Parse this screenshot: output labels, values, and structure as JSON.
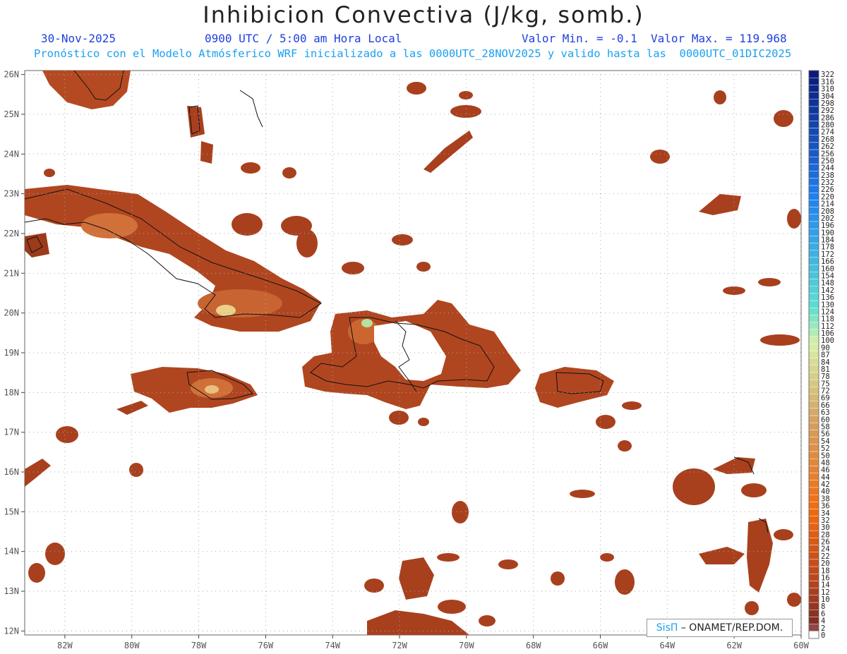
{
  "title": "Inhibicion Convectiva (J/kg, somb.)",
  "date": "30-Nov-2025",
  "time": "0900 UTC / 5:00 am Hora Local",
  "minmax": "Valor Min. = -0.1  Valor Max. = 119.968",
  "forecast": "Pronóstico con el Modelo Atmósferico WRF inicializado a las 0000UTC_28NOV2025 y valido hasta las  0000UTC_01DIC2025",
  "credit": {
    "brand": "SisΠ",
    "text": " – ONAMET/REP.DOM."
  },
  "map": {
    "lon_labels": [
      "82W",
      "80W",
      "78W",
      "76W",
      "74W",
      "72W",
      "70W",
      "68W",
      "66W",
      "64W",
      "62W",
      "60W"
    ],
    "lon_values": [
      -82,
      -80,
      -78,
      -76,
      -74,
      -72,
      -70,
      -68,
      -66,
      -64,
      -62,
      -60
    ],
    "lat_labels": [
      "26N",
      "25N",
      "24N",
      "23N",
      "22N",
      "21N",
      "20N",
      "19N",
      "18N",
      "17N",
      "16N",
      "15N",
      "14N",
      "13N",
      "12N"
    ],
    "lat_values": [
      26,
      25,
      24,
      23,
      22,
      21,
      20,
      19,
      18,
      17,
      16,
      15,
      14,
      13,
      12
    ],
    "lon_range": [
      -83.2,
      -60
    ],
    "lat_range": [
      11.9,
      26.1
    ],
    "grid": true
  },
  "colorbar": {
    "labels": [
      "322",
      "316",
      "310",
      "304",
      "298",
      "292",
      "286",
      "280",
      "274",
      "268",
      "262",
      "256",
      "250",
      "244",
      "238",
      "232",
      "226",
      "220",
      "214",
      "208",
      "202",
      "196",
      "190",
      "184",
      "178",
      "172",
      "166",
      "160",
      "154",
      "148",
      "142",
      "136",
      "130",
      "124",
      "118",
      "112",
      "106",
      "100",
      "90",
      "87",
      "84",
      "81",
      "78",
      "75",
      "72",
      "69",
      "66",
      "63",
      "60",
      "58",
      "56",
      "54",
      "52",
      "50",
      "48",
      "46",
      "44",
      "42",
      "40",
      "38",
      "36",
      "34",
      "32",
      "30",
      "28",
      "26",
      "24",
      "22",
      "20",
      "18",
      "16",
      "14",
      "12",
      "10",
      "8",
      "6",
      "4",
      "2",
      "0"
    ],
    "colors": {
      "top": "#0a1a7a",
      "mid_blue": "#2080f0",
      "cyan": "#60e0d0",
      "pale": "#d8f0a8",
      "tan": "#d4a060",
      "orange": "#f06a10",
      "rust": "#b8471f",
      "dark": "#7a2a22"
    }
  },
  "field_colors": {
    "main": "#a8401e",
    "mid": "#c85a28",
    "light": "#e08a3a",
    "peak": "#b8e0a0"
  }
}
